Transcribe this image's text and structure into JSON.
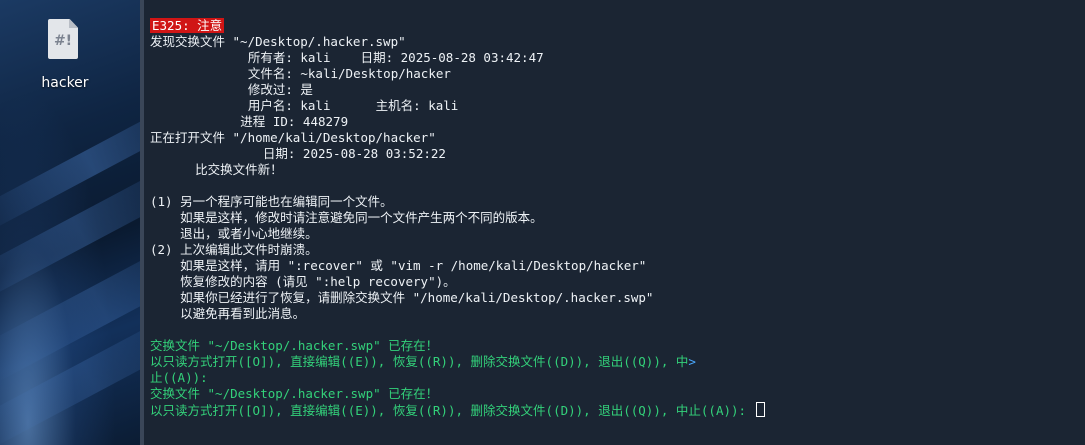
{
  "desktop": {
    "file_icon": "text-file-icon",
    "file_glyph": "#!",
    "file_label": "hacker"
  },
  "terminal": {
    "error_code": "E325: 注意",
    "lines": [
      "发现交换文件 \"~/Desktop/.hacker.swp\"",
      "             所有者: kali    日期: 2025-08-28 03:42:47",
      "             文件名: ~kali/Desktop/hacker",
      "             修改过: 是",
      "             用户名: kali      主机名: kali",
      "            进程 ID: 448279",
      "正在打开文件 \"/home/kali/Desktop/hacker\"",
      "               日期: 2025-08-28 03:52:22",
      "      比交换文件新！",
      "",
      "(1) 另一个程序可能也在编辑同一个文件。",
      "    如果是这样，修改时请注意避免同一个文件产生两个不同的版本。",
      "    退出，或者小心地继续。",
      "(2) 上次编辑此文件时崩溃。",
      "    如果是这样，请用 \":recover\" 或 \"vim -r /home/kali/Desktop/hacker\"",
      "    恢复修改的内容 (请见 \":help recovery\")。",
      "    如果你已经进行了恢复，请删除交换文件 \"/home/kali/Desktop/.hacker.swp\"",
      "    以避免再看到此消息。",
      ""
    ],
    "prompt_lines": [
      "交换文件 \"~/Desktop/.hacker.swp\" 已存在！",
      "以只读方式打开([O]), 直接编辑((E)), 恢复((R)), 删除交换文件((D)), 退出((Q)), 中",
      "止((A)):",
      "交换文件 \"~/Desktop/.hacker.swp\" 已存在！",
      "以只读方式打开([O]), 直接编辑((E)), 恢复((R)), 删除交换文件((D)), 退出((Q)), 中止((A)): "
    ],
    "more_marker": ">"
  },
  "colors": {
    "terminal_bg": "#1b2533",
    "text": "#eef2f6",
    "prompt_green": "#33d17a",
    "error_red": "#d01515"
  }
}
